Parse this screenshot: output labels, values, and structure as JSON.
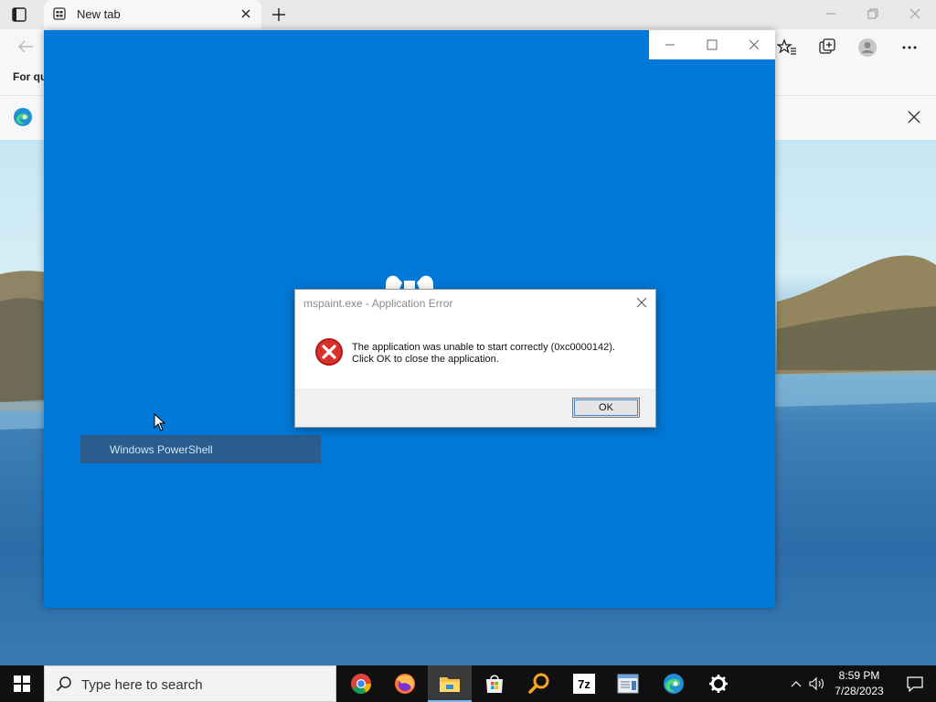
{
  "browser": {
    "tab_title": "New tab",
    "favorites_bar_text": "For qu"
  },
  "app_window": {
    "list_item": "Windows PowerShell"
  },
  "dialog": {
    "title": "mspaint.exe - Application Error",
    "message_line1": "The application was unable to start correctly (0xc0000142).",
    "message_line2": "Click OK to close the application.",
    "ok_label": "OK"
  },
  "taskbar": {
    "search_placeholder": "Type here to search",
    "time": "8:59 PM",
    "date": "7/28/2023",
    "pinned": [
      "chrome-icon",
      "firefox-icon",
      "file-explorer-icon",
      "store-icon",
      "search-tool-icon",
      "7zip-icon",
      "notepad-icon",
      "edge-icon",
      "settings-icon"
    ]
  },
  "colors": {
    "app_blue": "#0078d7",
    "error_red": "#c42b1c",
    "taskbar": "#101010"
  }
}
